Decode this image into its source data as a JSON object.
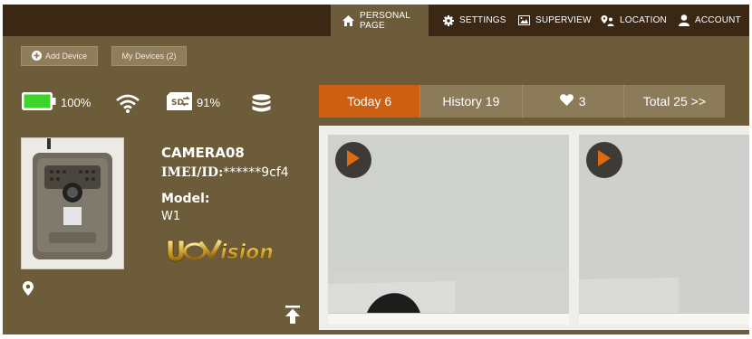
{
  "nav": {
    "personal": "PERSONAL PAGE",
    "settings": "SETTINGS",
    "superview": "SUPERVIEW",
    "location": "LOCATION",
    "account": "ACCOUNT"
  },
  "buttons": {
    "add_device": "Add Device",
    "my_devices": "My Devices (2)"
  },
  "status": {
    "battery": "100%",
    "sd_card": "91%"
  },
  "tabs": {
    "today": "Today 6",
    "history": "History 19",
    "favorites_count": "3",
    "total": "Total 25 >>"
  },
  "device": {
    "name": "CAMERA08",
    "imei_label": "IMEI/ID:",
    "imei_value": "******9cf4",
    "model_label": "Model:",
    "model_value": "W1",
    "brand_logo": "UOVision"
  },
  "colors": {
    "active_tab": "#cc5f12",
    "nav_bar": "#3a2814",
    "panel": "#6c5c39",
    "battery": "#3cd32a"
  },
  "icons": [
    "home-icon",
    "gear-icon",
    "picture-icon",
    "location-people-icon",
    "user-icon",
    "plus-circle-icon",
    "battery-icon",
    "wifi-icon",
    "sd-card-icon",
    "database-icon",
    "heart-icon",
    "map-pin-icon",
    "arrow-to-top-icon",
    "play-icon"
  ]
}
